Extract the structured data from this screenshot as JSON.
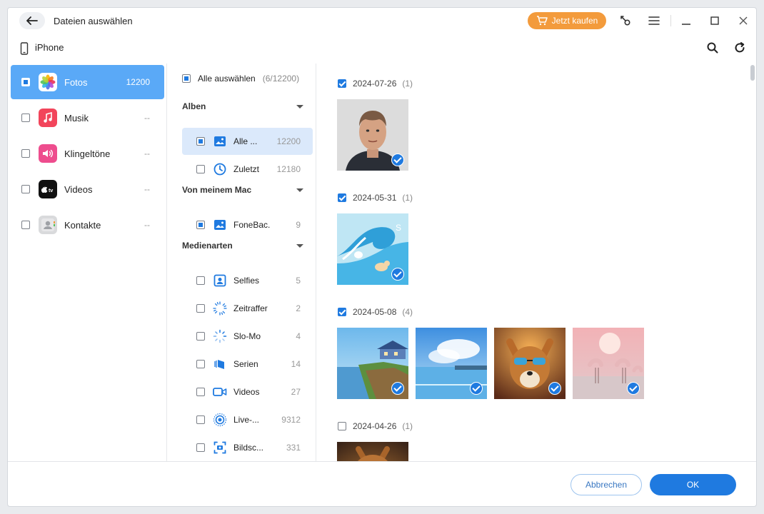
{
  "window": {
    "title": "Dateien auswählen",
    "buy_label": "Jetzt kaufen"
  },
  "device": {
    "name": "iPhone"
  },
  "categories": [
    {
      "label": "Fotos",
      "count": "12200",
      "icon": "photos-app-icon",
      "color": "#ffffff",
      "selected": true
    },
    {
      "label": "Musik",
      "count": "--",
      "icon": "music-app-icon",
      "color": "#f2455b"
    },
    {
      "label": "Klingeltöne",
      "count": "--",
      "icon": "ringtones-app-icon",
      "color": "#ee4d8e"
    },
    {
      "label": "Videos",
      "count": "--",
      "icon": "appletv-app-icon",
      "color": "#111111"
    },
    {
      "label": "Kontakte",
      "count": "--",
      "icon": "contacts-app-icon",
      "color": "#d9dadc"
    }
  ],
  "albums_panel": {
    "select_all_label": "Alle auswählen",
    "select_all_count": "(6/12200)",
    "sections": {
      "alben": "Alben",
      "mac": "Von meinem Mac",
      "media": "Medienarten"
    },
    "alben": [
      {
        "label": "Alle ...",
        "count": "12200",
        "icon": "album-icon"
      },
      {
        "label": "Zuletzt",
        "count": "12180",
        "icon": "clock-icon"
      }
    ],
    "mac": [
      {
        "label": "FoneBac...",
        "count": "9",
        "icon": "album-icon"
      }
    ],
    "media": [
      {
        "label": "Selfies",
        "count": "5",
        "icon": "selfie-icon"
      },
      {
        "label": "Zeitraffer",
        "count": "2",
        "icon": "timelapse-icon"
      },
      {
        "label": "Slo-Mo",
        "count": "4",
        "icon": "slomo-icon"
      },
      {
        "label": "Serien",
        "count": "14",
        "icon": "burst-icon"
      },
      {
        "label": "Videos",
        "count": "27",
        "icon": "video-icon"
      },
      {
        "label": "Live-...",
        "count": "9312",
        "icon": "live-photo-icon"
      },
      {
        "label": "Bildsc...",
        "count": "331",
        "icon": "screenshot-icon"
      }
    ]
  },
  "gallery": {
    "groups": [
      {
        "date": "2024-07-26",
        "count": "(1)",
        "checked": true
      },
      {
        "date": "2024-05-31",
        "count": "(1)",
        "checked": true
      },
      {
        "date": "2024-05-08",
        "count": "(4)",
        "checked": true
      },
      {
        "date": "2024-04-26",
        "count": "(1)",
        "checked": false
      }
    ]
  },
  "footer": {
    "cancel_label": "Abbrechen",
    "ok_label": "OK"
  },
  "colors": {
    "accent": "#1f7ae0",
    "active_category": "#5aa9f7",
    "active_album": "#dbe9fb",
    "buy_button": "#f39b3c"
  }
}
